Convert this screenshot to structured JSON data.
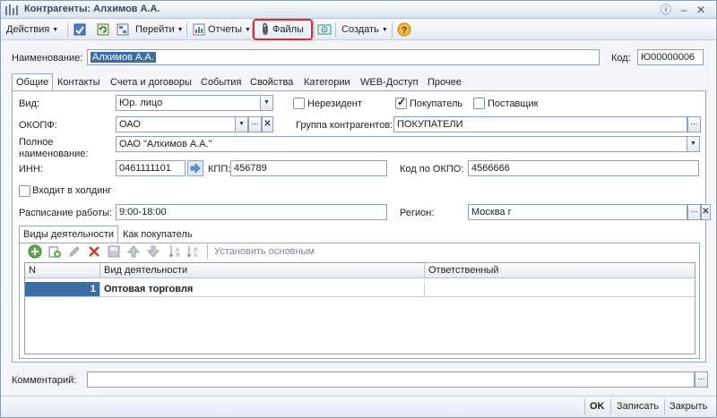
{
  "window": {
    "title": "Контрагенты: Алхимов А.А."
  },
  "toolbar": {
    "actions": "Действия",
    "goto": "Перейти",
    "reports": "Отчеты",
    "files": "Файлы",
    "create": "Создать"
  },
  "header": {
    "name_label": "Наименование:",
    "name_value": "Алхимов А.А.",
    "code_label": "Код:",
    "code_value": "Ю00000006"
  },
  "tabs": [
    "Общие",
    "Контакты",
    "Счета и договоры",
    "События",
    "Свойства",
    "Категории",
    "WEB-Доступ",
    "Прочее"
  ],
  "general": {
    "kind_label": "Вид:",
    "kind_value": "Юр. лицо",
    "nonresident": "Нерезидент",
    "buyer": "Покупатель",
    "supplier": "Поставщик",
    "okopf_label": "ОКОПФ:",
    "okopf_value": "ОАО",
    "group_label": "Группа контрагентов:",
    "group_value": "ПОКУПАТЕЛИ",
    "fullname_label_1": "Полное",
    "fullname_label_2": "наименование:",
    "fullname_value": "ОАО \"Алхимов А.А.\"",
    "inn_label": "ИНН:",
    "inn_value": "0461111101",
    "kpp_label": "КПП:",
    "kpp_value": "456789",
    "okpo_label": "Код по ОКПО:",
    "okpo_value": "4566666",
    "holding_label": "Входит в холдинг",
    "schedule_label": "Расписание работы:",
    "schedule_value": "9:00-18:00",
    "region_label": "Регион:",
    "region_value": "Москва г"
  },
  "subtabs": [
    "Виды деятельности",
    "Как покупатель"
  ],
  "subtoolbar": {
    "set_main": "Установить основным"
  },
  "table": {
    "headers": [
      "N",
      "Вид деятельности",
      "Ответственный"
    ],
    "rows": [
      {
        "n": "1",
        "activity": "Оптовая торговля",
        "responsible": ""
      }
    ]
  },
  "comment": {
    "label": "Комментарий:",
    "value": ""
  },
  "footer": {
    "ok": "OK",
    "save": "Записать",
    "close": "Закрыть"
  },
  "colors": {
    "highlight_border": "#e5262b",
    "selection": "#3a6ea5"
  }
}
